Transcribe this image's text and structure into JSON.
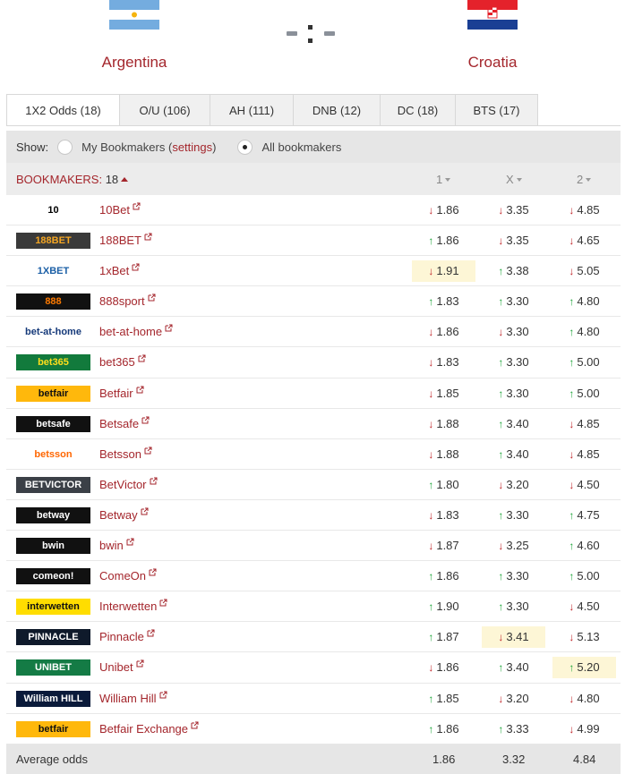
{
  "match": {
    "home": {
      "name": "Argentina",
      "flag": "argentina-flag"
    },
    "away": {
      "name": "Croatia",
      "flag": "croatia-flag"
    },
    "score": "-:-"
  },
  "tabs": [
    {
      "label": "1X2 Odds (18)",
      "active": true
    },
    {
      "label": "O/U (106)"
    },
    {
      "label": "AH (111)"
    },
    {
      "label": "DNB (12)"
    },
    {
      "label": "DC (18)"
    },
    {
      "label": "BTS (17)"
    }
  ],
  "filter": {
    "show_label": "Show:",
    "my_bookmakers": "My Bookmakers",
    "settings_open": "(",
    "settings_link": "settings",
    "settings_close": ")",
    "all_bookmakers": "All bookmakers",
    "selected": "all"
  },
  "table_header": {
    "bookmakers_label": "BOOKMAKERS:",
    "bookmakers_count": "18",
    "col1": "1",
    "colx": "X",
    "col2": "2"
  },
  "bookmakers": [
    {
      "name": "10Bet",
      "logo": "10bet-logo",
      "o1": "1.86",
      "t1": "down",
      "ox": "3.35",
      "tx": "down",
      "o2": "4.85",
      "t2": "down"
    },
    {
      "name": "188BET",
      "logo": "188bet-logo",
      "o1": "1.86",
      "t1": "up",
      "ox": "3.35",
      "tx": "down",
      "o2": "4.65",
      "t2": "down"
    },
    {
      "name": "1xBet",
      "logo": "1xbet-logo",
      "o1": "1.91",
      "t1": "down",
      "h1": true,
      "ox": "3.38",
      "tx": "up",
      "o2": "5.05",
      "t2": "down"
    },
    {
      "name": "888sport",
      "logo": "888sport-logo",
      "o1": "1.83",
      "t1": "up",
      "ox": "3.30",
      "tx": "up",
      "o2": "4.80",
      "t2": "up"
    },
    {
      "name": "bet-at-home",
      "logo": "bet-at-home-logo",
      "o1": "1.86",
      "t1": "down",
      "ox": "3.30",
      "tx": "down",
      "o2": "4.80",
      "t2": "up"
    },
    {
      "name": "bet365",
      "logo": "bet365-logo",
      "o1": "1.83",
      "t1": "down",
      "ox": "3.30",
      "tx": "up",
      "o2": "5.00",
      "t2": "up"
    },
    {
      "name": "Betfair",
      "logo": "betfair-logo",
      "o1": "1.85",
      "t1": "down",
      "ox": "3.30",
      "tx": "up",
      "o2": "5.00",
      "t2": "up"
    },
    {
      "name": "Betsafe",
      "logo": "betsafe-logo",
      "o1": "1.88",
      "t1": "down",
      "ox": "3.40",
      "tx": "up",
      "o2": "4.85",
      "t2": "down"
    },
    {
      "name": "Betsson",
      "logo": "betsson-logo",
      "o1": "1.88",
      "t1": "down",
      "ox": "3.40",
      "tx": "up",
      "o2": "4.85",
      "t2": "down"
    },
    {
      "name": "BetVictor",
      "logo": "betvictor-logo",
      "o1": "1.80",
      "t1": "up",
      "ox": "3.20",
      "tx": "down",
      "o2": "4.50",
      "t2": "down"
    },
    {
      "name": "Betway",
      "logo": "betway-logo",
      "o1": "1.83",
      "t1": "down",
      "ox": "3.30",
      "tx": "up",
      "o2": "4.75",
      "t2": "up"
    },
    {
      "name": "bwin",
      "logo": "bwin-logo",
      "o1": "1.87",
      "t1": "down",
      "ox": "3.25",
      "tx": "down",
      "o2": "4.60",
      "t2": "up"
    },
    {
      "name": "ComeOn",
      "logo": "comeon-logo",
      "o1": "1.86",
      "t1": "up",
      "ox": "3.30",
      "tx": "up",
      "o2": "5.00",
      "t2": "up"
    },
    {
      "name": "Interwetten",
      "logo": "interwetten-logo",
      "o1": "1.90",
      "t1": "up",
      "ox": "3.30",
      "tx": "up",
      "o2": "4.50",
      "t2": "down"
    },
    {
      "name": "Pinnacle",
      "logo": "pinnacle-logo",
      "o1": "1.87",
      "t1": "up",
      "ox": "3.41",
      "tx": "down",
      "hx": true,
      "o2": "5.13",
      "t2": "down"
    },
    {
      "name": "Unibet",
      "logo": "unibet-logo",
      "o1": "1.86",
      "t1": "down",
      "ox": "3.40",
      "tx": "up",
      "o2": "5.20",
      "t2": "up",
      "h2": true
    },
    {
      "name": "William Hill",
      "logo": "william-hill-logo",
      "o1": "1.85",
      "t1": "up",
      "ox": "3.20",
      "tx": "down",
      "o2": "4.80",
      "t2": "down"
    },
    {
      "name": "Betfair Exchange",
      "logo": "betfair-exchange-logo",
      "o1": "1.86",
      "t1": "up",
      "ox": "3.33",
      "tx": "up",
      "o2": "4.99",
      "t2": "down"
    }
  ],
  "logos": {
    "10bet-logo": {
      "text": "10",
      "bg": "#ffffff",
      "fg": "#000000"
    },
    "188bet-logo": {
      "text": "188BET",
      "bg": "#3a3a3a",
      "fg": "#f5a623"
    },
    "1xbet-logo": {
      "text": "1XBET",
      "bg": "#ffffff",
      "fg": "#1b5fa6"
    },
    "888sport-logo": {
      "text": "888",
      "bg": "#111111",
      "fg": "#ff7a00"
    },
    "bet-at-home-logo": {
      "text": "bet-at-home",
      "bg": "#ffffff",
      "fg": "#163a7a"
    },
    "bet365-logo": {
      "text": "bet365",
      "bg": "#127a3c",
      "fg": "#ffdf1b"
    },
    "betfair-logo": {
      "text": "betfair",
      "bg": "#ffb80c",
      "fg": "#111111"
    },
    "betsafe-logo": {
      "text": "betsafe",
      "bg": "#111111",
      "fg": "#ffffff"
    },
    "betsson-logo": {
      "text": "betsson",
      "bg": "#ffffff",
      "fg": "#ff6600"
    },
    "betvictor-logo": {
      "text": "BETVICTOR",
      "bg": "#3b4047",
      "fg": "#ffffff"
    },
    "betway-logo": {
      "text": "betway",
      "bg": "#111111",
      "fg": "#ffffff"
    },
    "bwin-logo": {
      "text": "bwin",
      "bg": "#111111",
      "fg": "#ffffff"
    },
    "comeon-logo": {
      "text": "comeon!",
      "bg": "#111111",
      "fg": "#ffffff"
    },
    "interwetten-logo": {
      "text": "interwetten",
      "bg": "#ffdd00",
      "fg": "#111111"
    },
    "pinnacle-logo": {
      "text": "PINNACLE",
      "bg": "#0f1a2b",
      "fg": "#ffffff"
    },
    "unibet-logo": {
      "text": "UNIBET",
      "bg": "#147b45",
      "fg": "#ffffff"
    },
    "william-hill-logo": {
      "text": "William HILL",
      "bg": "#0a1a3a",
      "fg": "#ffffff"
    },
    "betfair-exchange-logo": {
      "text": "betfair",
      "bg": "#ffb80c",
      "fg": "#111111"
    }
  },
  "average": {
    "label": "Average odds",
    "o1": "1.86",
    "ox": "3.32",
    "o2": "4.84"
  },
  "colors": {
    "accent": "#a4262c",
    "up": "#1fa53b",
    "down": "#c0262a",
    "highlight": "#fdf6d6"
  }
}
